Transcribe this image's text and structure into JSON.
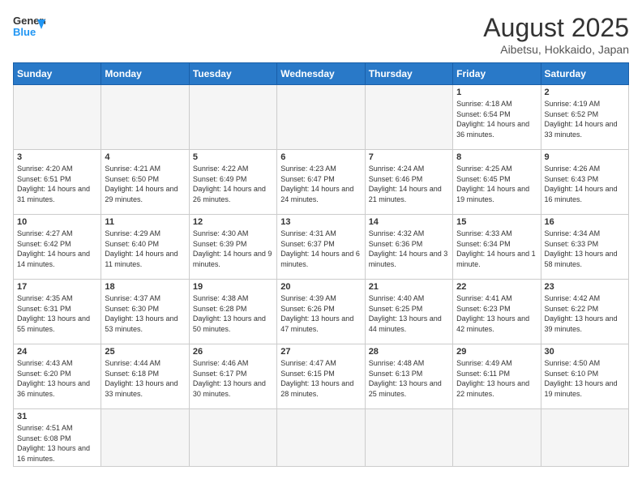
{
  "header": {
    "logo_general": "General",
    "logo_blue": "Blue",
    "month_title": "August 2025",
    "location": "Aibetsu, Hokkaido, Japan"
  },
  "days_of_week": [
    "Sunday",
    "Monday",
    "Tuesday",
    "Wednesday",
    "Thursday",
    "Friday",
    "Saturday"
  ],
  "weeks": [
    [
      {
        "day": "",
        "info": ""
      },
      {
        "day": "",
        "info": ""
      },
      {
        "day": "",
        "info": ""
      },
      {
        "day": "",
        "info": ""
      },
      {
        "day": "",
        "info": ""
      },
      {
        "day": "1",
        "info": "Sunrise: 4:18 AM\nSunset: 6:54 PM\nDaylight: 14 hours and 36 minutes."
      },
      {
        "day": "2",
        "info": "Sunrise: 4:19 AM\nSunset: 6:52 PM\nDaylight: 14 hours and 33 minutes."
      }
    ],
    [
      {
        "day": "3",
        "info": "Sunrise: 4:20 AM\nSunset: 6:51 PM\nDaylight: 14 hours and 31 minutes."
      },
      {
        "day": "4",
        "info": "Sunrise: 4:21 AM\nSunset: 6:50 PM\nDaylight: 14 hours and 29 minutes."
      },
      {
        "day": "5",
        "info": "Sunrise: 4:22 AM\nSunset: 6:49 PM\nDaylight: 14 hours and 26 minutes."
      },
      {
        "day": "6",
        "info": "Sunrise: 4:23 AM\nSunset: 6:47 PM\nDaylight: 14 hours and 24 minutes."
      },
      {
        "day": "7",
        "info": "Sunrise: 4:24 AM\nSunset: 6:46 PM\nDaylight: 14 hours and 21 minutes."
      },
      {
        "day": "8",
        "info": "Sunrise: 4:25 AM\nSunset: 6:45 PM\nDaylight: 14 hours and 19 minutes."
      },
      {
        "day": "9",
        "info": "Sunrise: 4:26 AM\nSunset: 6:43 PM\nDaylight: 14 hours and 16 minutes."
      }
    ],
    [
      {
        "day": "10",
        "info": "Sunrise: 4:27 AM\nSunset: 6:42 PM\nDaylight: 14 hours and 14 minutes."
      },
      {
        "day": "11",
        "info": "Sunrise: 4:29 AM\nSunset: 6:40 PM\nDaylight: 14 hours and 11 minutes."
      },
      {
        "day": "12",
        "info": "Sunrise: 4:30 AM\nSunset: 6:39 PM\nDaylight: 14 hours and 9 minutes."
      },
      {
        "day": "13",
        "info": "Sunrise: 4:31 AM\nSunset: 6:37 PM\nDaylight: 14 hours and 6 minutes."
      },
      {
        "day": "14",
        "info": "Sunrise: 4:32 AM\nSunset: 6:36 PM\nDaylight: 14 hours and 3 minutes."
      },
      {
        "day": "15",
        "info": "Sunrise: 4:33 AM\nSunset: 6:34 PM\nDaylight: 14 hours and 1 minute."
      },
      {
        "day": "16",
        "info": "Sunrise: 4:34 AM\nSunset: 6:33 PM\nDaylight: 13 hours and 58 minutes."
      }
    ],
    [
      {
        "day": "17",
        "info": "Sunrise: 4:35 AM\nSunset: 6:31 PM\nDaylight: 13 hours and 55 minutes."
      },
      {
        "day": "18",
        "info": "Sunrise: 4:37 AM\nSunset: 6:30 PM\nDaylight: 13 hours and 53 minutes."
      },
      {
        "day": "19",
        "info": "Sunrise: 4:38 AM\nSunset: 6:28 PM\nDaylight: 13 hours and 50 minutes."
      },
      {
        "day": "20",
        "info": "Sunrise: 4:39 AM\nSunset: 6:26 PM\nDaylight: 13 hours and 47 minutes."
      },
      {
        "day": "21",
        "info": "Sunrise: 4:40 AM\nSunset: 6:25 PM\nDaylight: 13 hours and 44 minutes."
      },
      {
        "day": "22",
        "info": "Sunrise: 4:41 AM\nSunset: 6:23 PM\nDaylight: 13 hours and 42 minutes."
      },
      {
        "day": "23",
        "info": "Sunrise: 4:42 AM\nSunset: 6:22 PM\nDaylight: 13 hours and 39 minutes."
      }
    ],
    [
      {
        "day": "24",
        "info": "Sunrise: 4:43 AM\nSunset: 6:20 PM\nDaylight: 13 hours and 36 minutes."
      },
      {
        "day": "25",
        "info": "Sunrise: 4:44 AM\nSunset: 6:18 PM\nDaylight: 13 hours and 33 minutes."
      },
      {
        "day": "26",
        "info": "Sunrise: 4:46 AM\nSunset: 6:17 PM\nDaylight: 13 hours and 30 minutes."
      },
      {
        "day": "27",
        "info": "Sunrise: 4:47 AM\nSunset: 6:15 PM\nDaylight: 13 hours and 28 minutes."
      },
      {
        "day": "28",
        "info": "Sunrise: 4:48 AM\nSunset: 6:13 PM\nDaylight: 13 hours and 25 minutes."
      },
      {
        "day": "29",
        "info": "Sunrise: 4:49 AM\nSunset: 6:11 PM\nDaylight: 13 hours and 22 minutes."
      },
      {
        "day": "30",
        "info": "Sunrise: 4:50 AM\nSunset: 6:10 PM\nDaylight: 13 hours and 19 minutes."
      }
    ],
    [
      {
        "day": "31",
        "info": "Sunrise: 4:51 AM\nSunset: 6:08 PM\nDaylight: 13 hours and 16 minutes."
      },
      {
        "day": "",
        "info": ""
      },
      {
        "day": "",
        "info": ""
      },
      {
        "day": "",
        "info": ""
      },
      {
        "day": "",
        "info": ""
      },
      {
        "day": "",
        "info": ""
      },
      {
        "day": "",
        "info": ""
      }
    ]
  ]
}
